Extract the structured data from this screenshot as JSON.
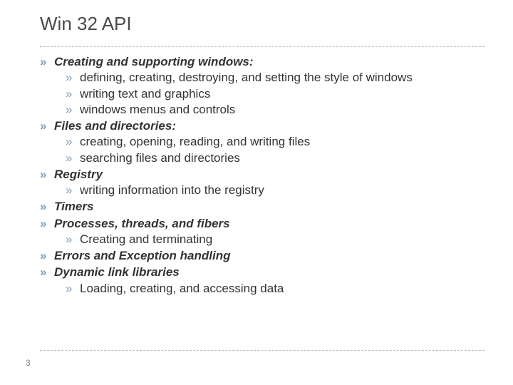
{
  "title": "Win 32 API",
  "items": [
    {
      "label": "Creating and supporting windows:",
      "sub": [
        "defining, creating, destroying, and setting the style of windows",
        "writing text and graphics",
        "windows menus and controls"
      ]
    },
    {
      "label": "Files and directories:",
      "sub": [
        "creating, opening, reading, and writing files",
        "searching files and directories"
      ]
    },
    {
      "label": "Registry",
      "sub": [
        "writing information into the registry"
      ]
    },
    {
      "label": "Timers",
      "sub": []
    },
    {
      "label": "Processes, threads, and fibers",
      "sub": [
        "Creating and terminating"
      ]
    },
    {
      "label": "Errors and Exception handling",
      "sub": []
    },
    {
      "label": "Dynamic link libraries",
      "sub": [
        "Loading, creating, and accessing data"
      ]
    }
  ],
  "bullet_glyph": "»",
  "page_number": "3"
}
